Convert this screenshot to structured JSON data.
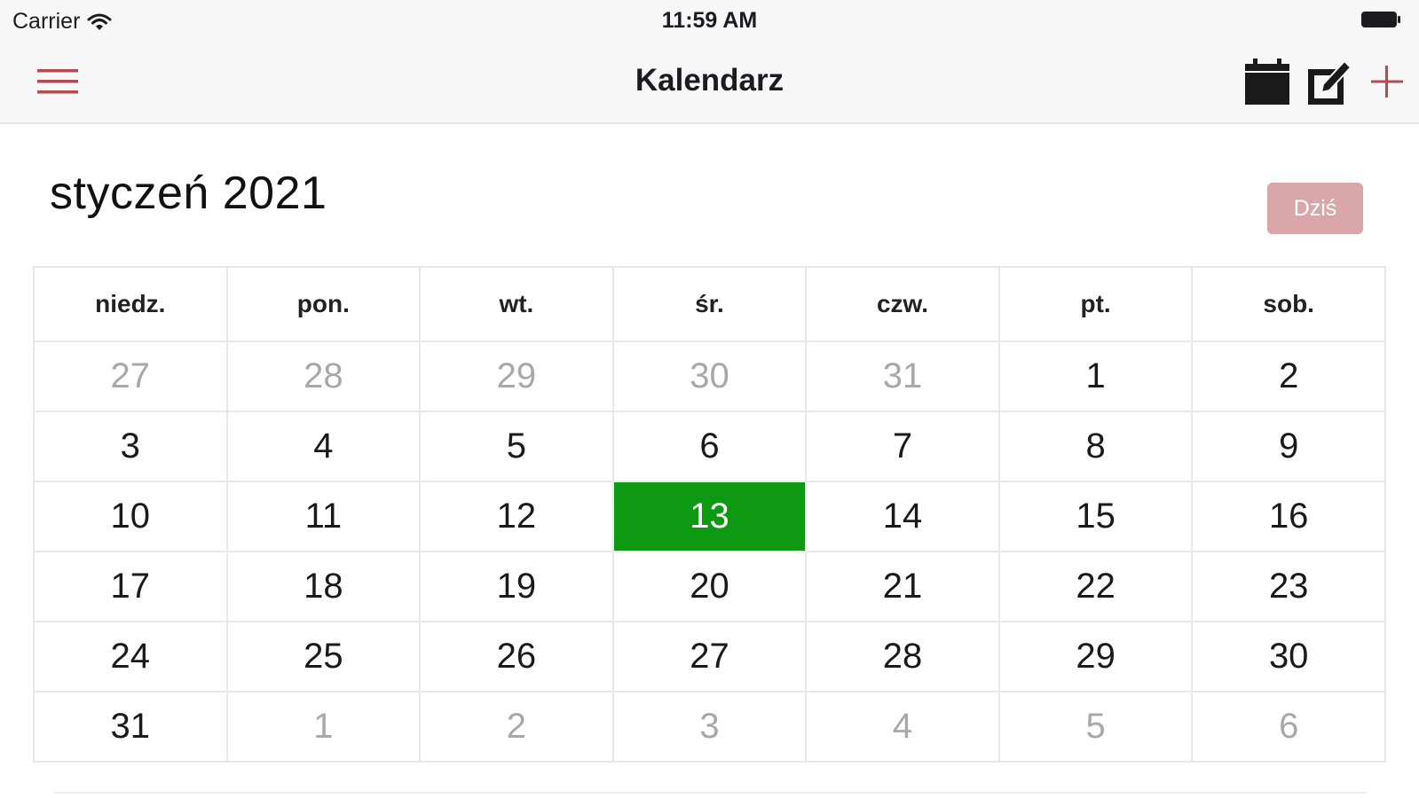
{
  "status_bar": {
    "carrier": "Carrier",
    "time": "11:59 AM"
  },
  "nav": {
    "title": "Kalendarz",
    "accent_color": "#b34b55"
  },
  "calendar": {
    "month_title": "styczeń 2021",
    "today_button": "Dziś",
    "weekdays": [
      "niedz.",
      "pon.",
      "wt.",
      "śr.",
      "czw.",
      "pt.",
      "sob."
    ],
    "weeks": [
      [
        {
          "day": "27",
          "muted": true
        },
        {
          "day": "28",
          "muted": true
        },
        {
          "day": "29",
          "muted": true
        },
        {
          "day": "30",
          "muted": true
        },
        {
          "day": "31",
          "muted": true
        },
        {
          "day": "1"
        },
        {
          "day": "2"
        }
      ],
      [
        {
          "day": "3"
        },
        {
          "day": "4"
        },
        {
          "day": "5"
        },
        {
          "day": "6"
        },
        {
          "day": "7"
        },
        {
          "day": "8"
        },
        {
          "day": "9"
        }
      ],
      [
        {
          "day": "10"
        },
        {
          "day": "11"
        },
        {
          "day": "12"
        },
        {
          "day": "13",
          "today": true
        },
        {
          "day": "14"
        },
        {
          "day": "15"
        },
        {
          "day": "16"
        }
      ],
      [
        {
          "day": "17"
        },
        {
          "day": "18"
        },
        {
          "day": "19"
        },
        {
          "day": "20"
        },
        {
          "day": "21"
        },
        {
          "day": "22"
        },
        {
          "day": "23"
        }
      ],
      [
        {
          "day": "24"
        },
        {
          "day": "25"
        },
        {
          "day": "26"
        },
        {
          "day": "27"
        },
        {
          "day": "28"
        },
        {
          "day": "29"
        },
        {
          "day": "30"
        }
      ],
      [
        {
          "day": "31"
        },
        {
          "day": "1",
          "muted": true
        },
        {
          "day": "2",
          "muted": true
        },
        {
          "day": "3",
          "muted": true
        },
        {
          "day": "4",
          "muted": true
        },
        {
          "day": "5",
          "muted": true
        },
        {
          "day": "6",
          "muted": true
        }
      ]
    ],
    "today_color": "#0d9a12",
    "today_button_color": "#d9a7aa"
  }
}
